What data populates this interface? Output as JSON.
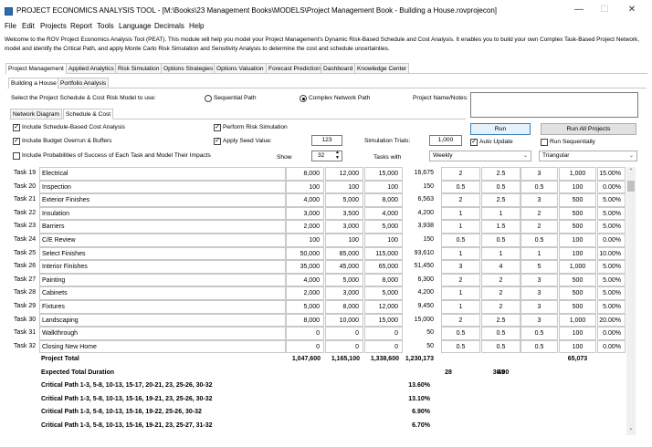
{
  "window": {
    "title": "PROJECT ECONOMICS ANALYSIS TOOL - [M:\\Books\\23 Management Books\\MODELS\\Project Management Book - Building a House.rovprojecon]",
    "minimize": "—",
    "maximize": "☐",
    "close": "✕"
  },
  "menu": [
    "File",
    "Edit",
    "Projects",
    "Report",
    "Tools",
    "Language",
    "Decimals",
    "Help"
  ],
  "welcome": "Welcome to the ROV Project Economics Analysis Tool (PEAT). This module will help you model your Project Management's Dynamic Risk-Based Schedule and Cost Analysis. It enables you to build your own Complex Task-Based Project Network, model and identify the Critical Path, and apply Monte Carlo Risk Simulation and Sensitivity Analysis to determine the cost and schedule uncertainties.",
  "main_tabs": [
    "Project Management",
    "Applied Analytics",
    "Risk Simulation",
    "Options Strategies",
    "Options Valuation",
    "Forecast Prediction",
    "Dashboard",
    "Knowledge Center"
  ],
  "sub_tabs": [
    "Building a House",
    "Portfolio Analysis"
  ],
  "select_model_label": "Select the Project Schedule & Cost Risk Model to use:",
  "radio_sequential": "Sequential Path",
  "radio_complex": "Complex Network Path",
  "project_name_label": "Project Name/Notes:",
  "inner_tabs": [
    "Network Diagram",
    "Schedule & Cost"
  ],
  "options": {
    "include_schedule": "Include Schedule-Based Cost Analysis",
    "include_budget": "Include Budget Overrun & Buffers",
    "include_probabilities": "Include Probabilities of Success of Each Task and Model Their Impacts",
    "perform_risk": "Perform Risk Simulation",
    "apply_seed": "Apply Seed Value:",
    "seed_value": "123",
    "sim_trials_label": "Simulation Trials:",
    "sim_trials_value": "1,000",
    "show_label": "Show",
    "show_value": "32",
    "tasks_with_label": "Tasks with",
    "tasks_with_value": "Weekly",
    "distribution_value": "Triangular",
    "run": "Run",
    "run_all": "Run All Projects",
    "auto_update": "Auto Update",
    "run_sequentially": "Run Sequentially"
  },
  "tasks": [
    {
      "id": "Task 19",
      "name": "Electrical",
      "min": "8,000",
      "likely": "12,000",
      "max": "15,000",
      "calc": "16,675",
      "d1": "2",
      "d2": "2.5",
      "d3": "3",
      "rate": "1,000",
      "pct": "15.00%"
    },
    {
      "id": "Task 20",
      "name": "Inspection",
      "min": "100",
      "likely": "100",
      "max": "100",
      "calc": "150",
      "d1": "0.5",
      "d2": "0.5",
      "d3": "0.5",
      "rate": "100",
      "pct": "0.00%"
    },
    {
      "id": "Task 21",
      "name": "Exterior Finishes",
      "min": "4,000",
      "likely": "5,000",
      "max": "8,000",
      "calc": "6,563",
      "d1": "2",
      "d2": "2.5",
      "d3": "3",
      "rate": "500",
      "pct": "5.00%"
    },
    {
      "id": "Task 22",
      "name": "Insulation",
      "min": "3,000",
      "likely": "3,500",
      "max": "4,000",
      "calc": "4,200",
      "d1": "1",
      "d2": "1",
      "d3": "2",
      "rate": "500",
      "pct": "5.00%"
    },
    {
      "id": "Task 23",
      "name": "Barriers",
      "min": "2,000",
      "likely": "3,000",
      "max": "5,000",
      "calc": "3,938",
      "d1": "1",
      "d2": "1.5",
      "d3": "2",
      "rate": "500",
      "pct": "5.00%"
    },
    {
      "id": "Task 24",
      "name": "C/E Review",
      "min": "100",
      "likely": "100",
      "max": "100",
      "calc": "150",
      "d1": "0.5",
      "d2": "0.5",
      "d3": "0.5",
      "rate": "100",
      "pct": "0.00%"
    },
    {
      "id": "Task 25",
      "name": "Select Finishes",
      "min": "50,000",
      "likely": "85,000",
      "max": "115,000",
      "calc": "93,610",
      "d1": "1",
      "d2": "1",
      "d3": "1",
      "rate": "100",
      "pct": "10.00%"
    },
    {
      "id": "Task 26",
      "name": "Interior Finishes",
      "min": "35,000",
      "likely": "45,000",
      "max": "65,000",
      "calc": "51,450",
      "d1": "3",
      "d2": "4",
      "d3": "5",
      "rate": "1,000",
      "pct": "5.00%"
    },
    {
      "id": "Task 27",
      "name": "Painting",
      "min": "4,000",
      "likely": "5,000",
      "max": "8,000",
      "calc": "6,300",
      "d1": "2",
      "d2": "2",
      "d3": "3",
      "rate": "500",
      "pct": "5.00%"
    },
    {
      "id": "Task 28",
      "name": "Cabinets",
      "min": "2,000",
      "likely": "3,000",
      "max": "5,000",
      "calc": "4,200",
      "d1": "1",
      "d2": "2",
      "d3": "3",
      "rate": "500",
      "pct": "5.00%"
    },
    {
      "id": "Task 29",
      "name": "Fixtures",
      "min": "5,000",
      "likely": "8,000",
      "max": "12,000",
      "calc": "9,450",
      "d1": "1",
      "d2": "2",
      "d3": "3",
      "rate": "500",
      "pct": "5.00%"
    },
    {
      "id": "Task 30",
      "name": "Landscaping",
      "min": "8,000",
      "likely": "10,000",
      "max": "15,000",
      "calc": "15,000",
      "d1": "2",
      "d2": "2.5",
      "d3": "3",
      "rate": "1,000",
      "pct": "20.00%"
    },
    {
      "id": "Task 31",
      "name": "Walkthrough",
      "min": "0",
      "likely": "0",
      "max": "0",
      "calc": "50",
      "d1": "0.5",
      "d2": "0.5",
      "d3": "0.5",
      "rate": "100",
      "pct": "0.00%"
    },
    {
      "id": "Task 32",
      "name": "Closing New Home",
      "min": "0",
      "likely": "0",
      "max": "0",
      "calc": "50",
      "d1": "0.5",
      "d2": "0.5",
      "d3": "0.5",
      "rate": "100",
      "pct": "0.00%"
    }
  ],
  "totals": {
    "project_total_label": "Project Total",
    "min": "1,047,600",
    "likely": "1,165,100",
    "max": "1,338,600",
    "calc": "1,230,173",
    "rate_total": "65,073",
    "duration_label": "Expected Total Duration",
    "dur_min": "28",
    "dur_likely": "38.00",
    "dur_max": "49"
  },
  "critical_paths": [
    {
      "label": "Critical Path 1-3, 5-8, 10-13, 15-17, 20-21, 23, 25-26, 30-32",
      "pct": "13.60%"
    },
    {
      "label": "Critical Path 1-3, 5-8, 10-13, 15-16, 19-21, 23, 25-26, 30-32",
      "pct": "13.10%"
    },
    {
      "label": "Critical Path 1-3, 5-8, 10-13, 15-16, 19-22, 25-26, 30-32",
      "pct": "6.90%"
    },
    {
      "label": "Critical Path 1-3, 5-8, 10-13, 15-16, 19-21, 23, 25-27, 31-32",
      "pct": "6.70%"
    }
  ]
}
